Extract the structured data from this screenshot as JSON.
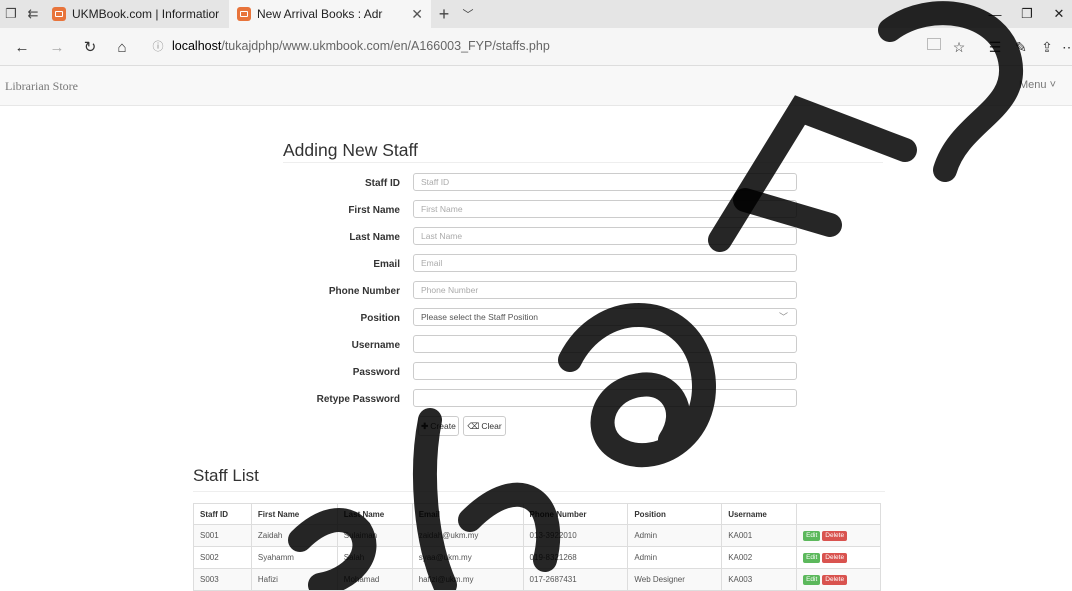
{
  "browser": {
    "tabs": [
      {
        "title": "UKMBook.com | Informatior"
      },
      {
        "title": "New Arrival Books : Adr"
      }
    ],
    "address": {
      "host": "localhost",
      "path": "/tukajdphp/www.ukmbook.com/en/A166003_FYP/staffs.php"
    }
  },
  "app": {
    "brand": "Librarian Store",
    "menu_label": "Menu ˅"
  },
  "form": {
    "title": "Adding New Staff",
    "fields": [
      {
        "label": "Staff ID",
        "placeholder": "Staff ID",
        "value": ""
      },
      {
        "label": "First Name",
        "placeholder": "First Name",
        "value": ""
      },
      {
        "label": "Last Name",
        "placeholder": "Last Name",
        "value": ""
      },
      {
        "label": "Email",
        "placeholder": "Email",
        "value": ""
      },
      {
        "label": "Phone Number",
        "placeholder": "Phone Number",
        "value": ""
      },
      {
        "label": "Position",
        "selected": "Please select the Staff Position"
      },
      {
        "label": "Username",
        "placeholder": "",
        "value": ""
      },
      {
        "label": "Password",
        "placeholder": "",
        "value": ""
      },
      {
        "label": "Retype Password",
        "placeholder": "",
        "value": ""
      }
    ],
    "create_label": "Create",
    "clear_label": "Clear"
  },
  "staff_list": {
    "title": "Staff List",
    "headers": [
      "Staff ID",
      "First Name",
      "Last Name",
      "Email",
      "Phone Number",
      "Position",
      "Username",
      ""
    ],
    "rows": [
      {
        "id": "S001",
        "first": "Zaidah",
        "last": "Sulaiman",
        "email": "zaidah@ukm.my",
        "phone": "013-3922010",
        "position": "Admin",
        "username": "KA001"
      },
      {
        "id": "S002",
        "first": "Syahamm",
        "last": "Salah",
        "email": "syaa@ukm.my",
        "phone": "019-8321268",
        "position": "Admin",
        "username": "KA002"
      },
      {
        "id": "S003",
        "first": "Hafizi",
        "last": "Mohamad",
        "email": "hafizi@ukm.my",
        "phone": "017-2687431",
        "position": "Web Designer",
        "username": "KA003"
      }
    ],
    "edit_label": "Edit",
    "delete_label": "Delete"
  },
  "icons": {
    "create": "plus-icon",
    "clear": "eraser-icon"
  }
}
